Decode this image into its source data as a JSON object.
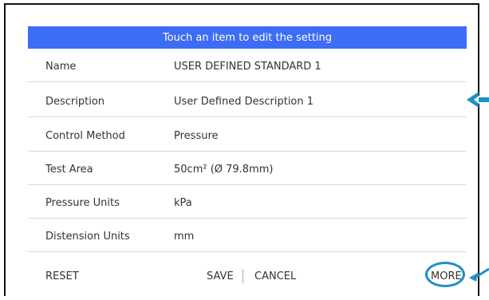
{
  "header": {
    "text": "Touch an item to edit the setting"
  },
  "rows": [
    {
      "label": "Name",
      "value": "USER DEFINED STANDARD 1"
    },
    {
      "label": "Description",
      "value": "User Defined Description 1"
    },
    {
      "label": "Control Method",
      "value": "Pressure"
    },
    {
      "label": "Test Area",
      "value": "50cm² (Ø 79.8mm)"
    },
    {
      "label": "Pressure Units",
      "value": "kPa"
    },
    {
      "label": "Distension Units",
      "value": "mm"
    }
  ],
  "footer": {
    "reset": "RESET",
    "save": "SAVE",
    "cancel": "CANCEL",
    "more": "MORE"
  },
  "colors": {
    "header_bg": "#3d6cf5",
    "annotation": "#1e90c8"
  },
  "icons": {
    "description_pointer": "arrow-left-icon",
    "more_pointer": "arrow-left-icon"
  }
}
